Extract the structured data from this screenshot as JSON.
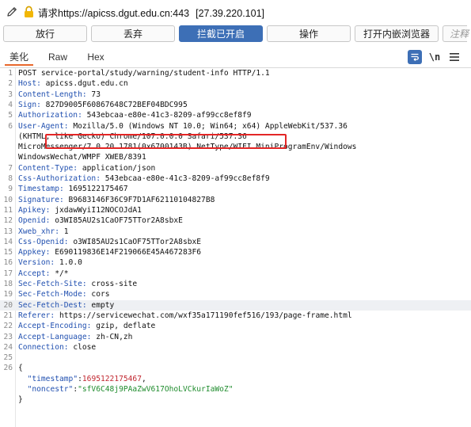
{
  "title_bar": {
    "prefix": "请求",
    "url": "https://apicss.dgut.edu.cn:443",
    "ip": "[27.39.220.101]"
  },
  "toolbar": {
    "buttons": [
      "放行",
      "丢弃",
      "拦截已开启",
      "操作",
      "打开内嵌浏览器"
    ],
    "active_index": 2,
    "search_placeholder": "注释",
    "accent_color": "#3d6fb6"
  },
  "tabs": {
    "items": [
      "美化",
      "Raw",
      "Hex"
    ],
    "active_index": 0,
    "icons": [
      "pretty-print-icon",
      "newline-icon",
      "menu-icon"
    ],
    "newline_label": "\\n",
    "active_underline_color": "#e8682c"
  },
  "request": {
    "highlighted_line": 22,
    "highlight_box_color": "#e32626",
    "lines": [
      {
        "n": "1",
        "parts": [
          {
            "t": "POST "
          },
          {
            "t": "service-portal/study/warning/student-info"
          },
          {
            "t": " HTTP/1.1"
          }
        ]
      },
      {
        "n": "2",
        "parts": [
          {
            "t": "Host:",
            "c": "hkey"
          },
          {
            "t": " apicss.dgut.edu.cn"
          }
        ]
      },
      {
        "n": "3",
        "parts": [
          {
            "t": "Content-Length:",
            "c": "hkey"
          },
          {
            "t": " 73"
          }
        ]
      },
      {
        "n": "4",
        "parts": [
          {
            "t": "Sign:",
            "c": "hkey"
          },
          {
            "t": " 827D9005F60867648C72BEF04BDC995"
          }
        ]
      },
      {
        "n": "5",
        "parts": [
          {
            "t": "Authorization:",
            "c": "hkey"
          },
          {
            "t": " 543ebcaa-e80e-41c3-8209-af99cc8ef8f9"
          }
        ]
      },
      {
        "n": "6",
        "parts": [
          {
            "t": "User-Agent:",
            "c": "hkey"
          },
          {
            "t": " Mozilla/5.0 (Windows NT 10.0; Win64; x64) AppleWebKit/537.36"
          }
        ]
      },
      {
        "n": "",
        "parts": [
          {
            "t": "(KHTML, like Gecko) Chrome/107.0.0.0 Safari/537.36"
          }
        ]
      },
      {
        "n": "",
        "parts": [
          {
            "t": "MicroMessenger/7.0.20.1781(0x6700143B) NetType/WIFI MiniProgramEnv/Windows"
          }
        ]
      },
      {
        "n": "",
        "parts": [
          {
            "t": "WindowsWechat/WMPF XWEB/8391"
          }
        ]
      },
      {
        "n": "7",
        "parts": [
          {
            "t": "Content-Type:",
            "c": "hkey"
          },
          {
            "t": " application/json"
          }
        ]
      },
      {
        "n": "8",
        "parts": [
          {
            "t": "Css-Authorization:",
            "c": "hkey"
          },
          {
            "t": " 543ebcaa-e80e-41c3-8209-af99cc8ef8f9"
          }
        ]
      },
      {
        "n": "9",
        "parts": [
          {
            "t": "Timestamp:",
            "c": "hkey"
          },
          {
            "t": " 1695122175467"
          }
        ]
      },
      {
        "n": "10",
        "parts": [
          {
            "t": "Signature:",
            "c": "hkey"
          },
          {
            "t": " B9683146F36C9F7D1AF62110104827B8"
          }
        ]
      },
      {
        "n": "11",
        "parts": [
          {
            "t": "Apikey:",
            "c": "hkey"
          },
          {
            "t": " jxdawWyiI12NOCOJdA1"
          }
        ]
      },
      {
        "n": "12",
        "parts": [
          {
            "t": "Openid:",
            "c": "hkey"
          },
          {
            "t": " o3WI85AU2s1CaOF75TTor2A8sbxE"
          }
        ]
      },
      {
        "n": "13",
        "parts": [
          {
            "t": "Xweb_xhr:",
            "c": "hkey"
          },
          {
            "t": " 1"
          }
        ]
      },
      {
        "n": "14",
        "parts": [
          {
            "t": "Css-Openid:",
            "c": "hkey"
          },
          {
            "t": " o3WI85AU2s1CaOF75TTor2A8sbxE"
          }
        ]
      },
      {
        "n": "15",
        "parts": [
          {
            "t": "Appkey:",
            "c": "hkey"
          },
          {
            "t": " E690119836E14F219066E45A467283F6"
          }
        ]
      },
      {
        "n": "16",
        "parts": [
          {
            "t": "Version:",
            "c": "hkey"
          },
          {
            "t": " 1.0.0"
          }
        ]
      },
      {
        "n": "17",
        "parts": [
          {
            "t": "Accept:",
            "c": "hkey"
          },
          {
            "t": " */*"
          }
        ]
      },
      {
        "n": "18",
        "parts": [
          {
            "t": "Sec-Fetch-Site:",
            "c": "hkey"
          },
          {
            "t": " cross-site"
          }
        ]
      },
      {
        "n": "19",
        "parts": [
          {
            "t": "Sec-Fetch-Mode:",
            "c": "hkey"
          },
          {
            "t": " cors"
          }
        ]
      },
      {
        "n": "20",
        "parts": [
          {
            "t": "Sec-Fetch-Dest:",
            "c": "hkey"
          },
          {
            "t": " empty"
          }
        ]
      },
      {
        "n": "21",
        "parts": [
          {
            "t": "Referer:",
            "c": "hkey"
          },
          {
            "t": " https://servicewechat.com/wxf35a171190fef516/193/page-frame.html"
          }
        ]
      },
      {
        "n": "22",
        "parts": [
          {
            "t": "Accept-Encoding:",
            "c": "hkey"
          },
          {
            "t": " gzip, deflate"
          }
        ]
      },
      {
        "n": "23",
        "parts": [
          {
            "t": "Accept-Language:",
            "c": "hkey"
          },
          {
            "t": " zh-CN,zh"
          }
        ]
      },
      {
        "n": "24",
        "parts": [
          {
            "t": "Connection:",
            "c": "hkey"
          },
          {
            "t": " close"
          }
        ]
      },
      {
        "n": "25",
        "parts": []
      },
      {
        "n": "26",
        "parts": [
          {
            "t": "{"
          }
        ]
      },
      {
        "n": "",
        "parts": [
          {
            "t": "  "
          },
          {
            "t": "\"timestamp\"",
            "c": "jkey"
          },
          {
            "t": ":"
          },
          {
            "t": "1695122175467",
            "c": "jnum"
          },
          {
            "t": ","
          }
        ]
      },
      {
        "n": "",
        "parts": [
          {
            "t": "  "
          },
          {
            "t": "\"noncestr\"",
            "c": "jkey"
          },
          {
            "t": ":"
          },
          {
            "t": "\"sfV6C48j9PAaZwV617OhoLVCkurIaWoZ\"",
            "c": "jstr"
          }
        ]
      },
      {
        "n": "",
        "parts": [
          {
            "t": "}"
          }
        ]
      }
    ]
  }
}
